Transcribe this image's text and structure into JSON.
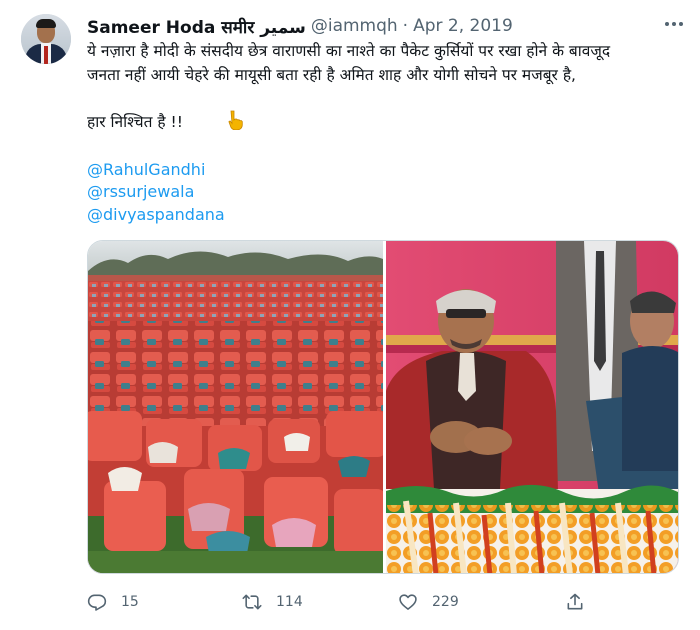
{
  "tweet": {
    "author_name": "Sameer Hoda समीर سمیر",
    "handle": "@iammqh",
    "separator": "·",
    "date": "Apr 2, 2019",
    "text_line1": "ये नज़ारा है मोदी के संसदीय छेत्र वाराणसी का नाश्ते का पैकेट कुर्सियों पर रखा होने के बावजूद",
    "text_line2": "जनता नहीं आयी चेहरे की मायूसी बता रही है अमित शाह और योगी सोचने पर मजबूर है,",
    "text_line3": "हार निश्चित है !!",
    "mentions": [
      "@RahulGandhi",
      "@rssurjewala",
      "@divyaspandana"
    ],
    "emoji_icon": "pointing-down-hand-icon",
    "images": [
      {
        "subject": "rows of red plastic chairs with snack packets in an open field"
      },
      {
        "subject": "men seated on a stage decorated with marigold garlands"
      }
    ]
  },
  "actions": {
    "reply_count": "15",
    "retweet_count": "114",
    "like_count": "229",
    "icons": [
      "reply-icon",
      "retweet-icon",
      "like-icon",
      "share-icon"
    ]
  },
  "colors": {
    "link": "#1d9bf0",
    "text_primary": "#0f1419",
    "text_secondary": "#536471",
    "border": "#cfd9de"
  }
}
